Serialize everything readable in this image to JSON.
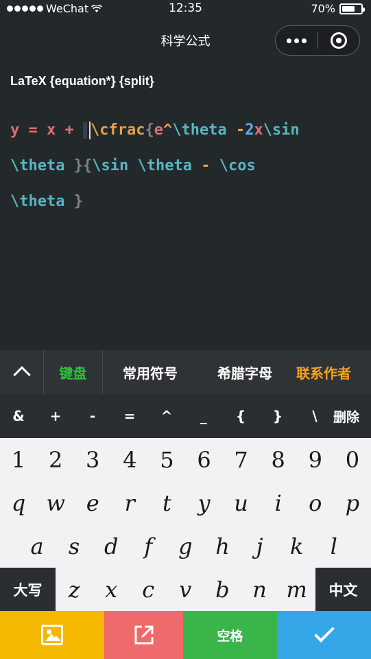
{
  "status_bar": {
    "carrier": "WeChat",
    "time": "12:35",
    "battery": "70%",
    "battery_level": 0.7
  },
  "nav": {
    "title": "科学公式"
  },
  "editor": {
    "mode_label": "LaTeX {equation*} {split}",
    "lines": [
      [
        {
          "t": "y = x + ",
          "c": "red"
        },
        {
          "t": "CURSOR",
          "c": "cursor"
        },
        {
          "t": "\\cfrac",
          "c": "orange"
        },
        {
          "t": "{",
          "c": "gray"
        },
        {
          "t": "e",
          "c": "red"
        },
        {
          "t": "^",
          "c": "orange"
        },
        {
          "t": "\\theta",
          "c": "cyan"
        },
        {
          "t": " -",
          "c": "orange"
        },
        {
          "t": "2",
          "c": "blue"
        },
        {
          "t": "x",
          "c": "red"
        },
        {
          "t": "\\sin",
          "c": "cyan"
        }
      ],
      [
        {
          "t": "\\theta",
          "c": "cyan"
        },
        {
          "t": " }{",
          "c": "gray"
        },
        {
          "t": "\\sin",
          "c": "cyan"
        },
        {
          "t": " ",
          "c": "gray"
        },
        {
          "t": "\\theta",
          "c": "cyan"
        },
        {
          "t": " - ",
          "c": "orange"
        },
        {
          "t": "\\cos",
          "c": "cyan"
        }
      ],
      [
        {
          "t": "\\theta",
          "c": "cyan"
        },
        {
          "t": " }",
          "c": "gray"
        }
      ]
    ]
  },
  "tabs": {
    "keyboard": "键盘",
    "common_symbols": "常用符号",
    "greek": "希腊字母",
    "contact": "联系作者"
  },
  "symbols": [
    "&",
    "+",
    "-",
    "=",
    "^",
    "_",
    "{",
    "}",
    "\\"
  ],
  "delete_label": "删除",
  "keyboard": {
    "row1": [
      "1",
      "2",
      "3",
      "4",
      "5",
      "6",
      "7",
      "8",
      "9",
      "0"
    ],
    "row2": [
      "q",
      "w",
      "e",
      "r",
      "t",
      "y",
      "u",
      "i",
      "o",
      "p"
    ],
    "row3": [
      "a",
      "s",
      "d",
      "f",
      "g",
      "h",
      "j",
      "k",
      "l"
    ],
    "row4": [
      "z",
      "x",
      "c",
      "v",
      "b",
      "n",
      "m"
    ],
    "caps_label": "大写",
    "chinese_label": "中文"
  },
  "actions": {
    "space_label": "空格"
  },
  "icons": {
    "up": "chevron-up-icon",
    "image": "image-icon",
    "share": "share-icon",
    "confirm": "check-icon"
  },
  "colors": {
    "red": "#e06c75",
    "orange": "#e5a14b",
    "cyan": "#56b6c2",
    "blue": "#61afef",
    "gray": "#7f848e",
    "keyboard_tab": "#2fbf3b",
    "contact_tab": "#f3a41a",
    "image_btn": "#f5b800",
    "share_btn": "#ef6a6a",
    "space_btn": "#39b54a",
    "confirm_btn": "#35a7e8"
  }
}
